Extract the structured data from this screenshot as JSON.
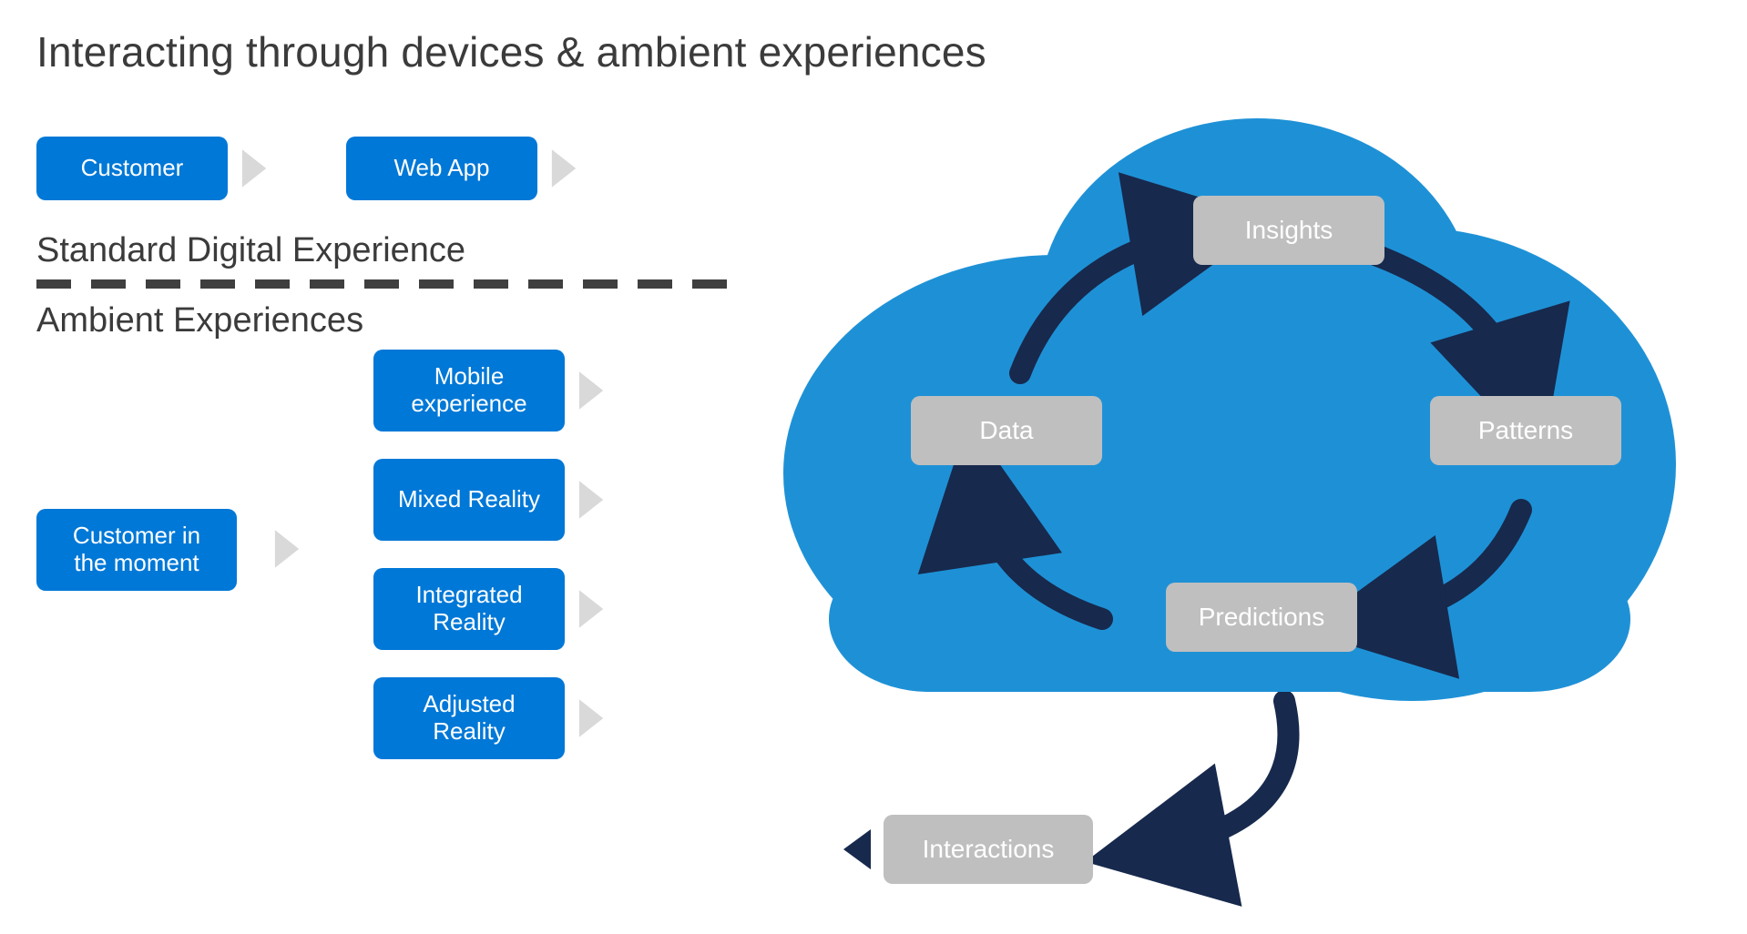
{
  "title": "Interacting through devices & ambient experiences",
  "standard": {
    "customer": "Customer",
    "webapp": "Web App",
    "heading": "Standard Digital Experience"
  },
  "ambient": {
    "heading": "Ambient Experiences",
    "customer": "Customer in the moment",
    "channels": [
      "Mobile experience",
      "Mixed Reality",
      "Integrated Reality",
      "Adjusted Reality"
    ]
  },
  "cloud": {
    "nodes": {
      "insights": "Insights",
      "patterns": "Patterns",
      "predictions": "Predictions",
      "data": "Data"
    },
    "output": "Interactions"
  },
  "colors": {
    "accent_blue": "#0078d7",
    "cloud_blue": "#1e91d6",
    "node_grey": "#bfbfbf",
    "arrow_navy": "#17294d",
    "chevron_grey": "#d9d9d9",
    "text_dark": "#3b3b3b"
  }
}
